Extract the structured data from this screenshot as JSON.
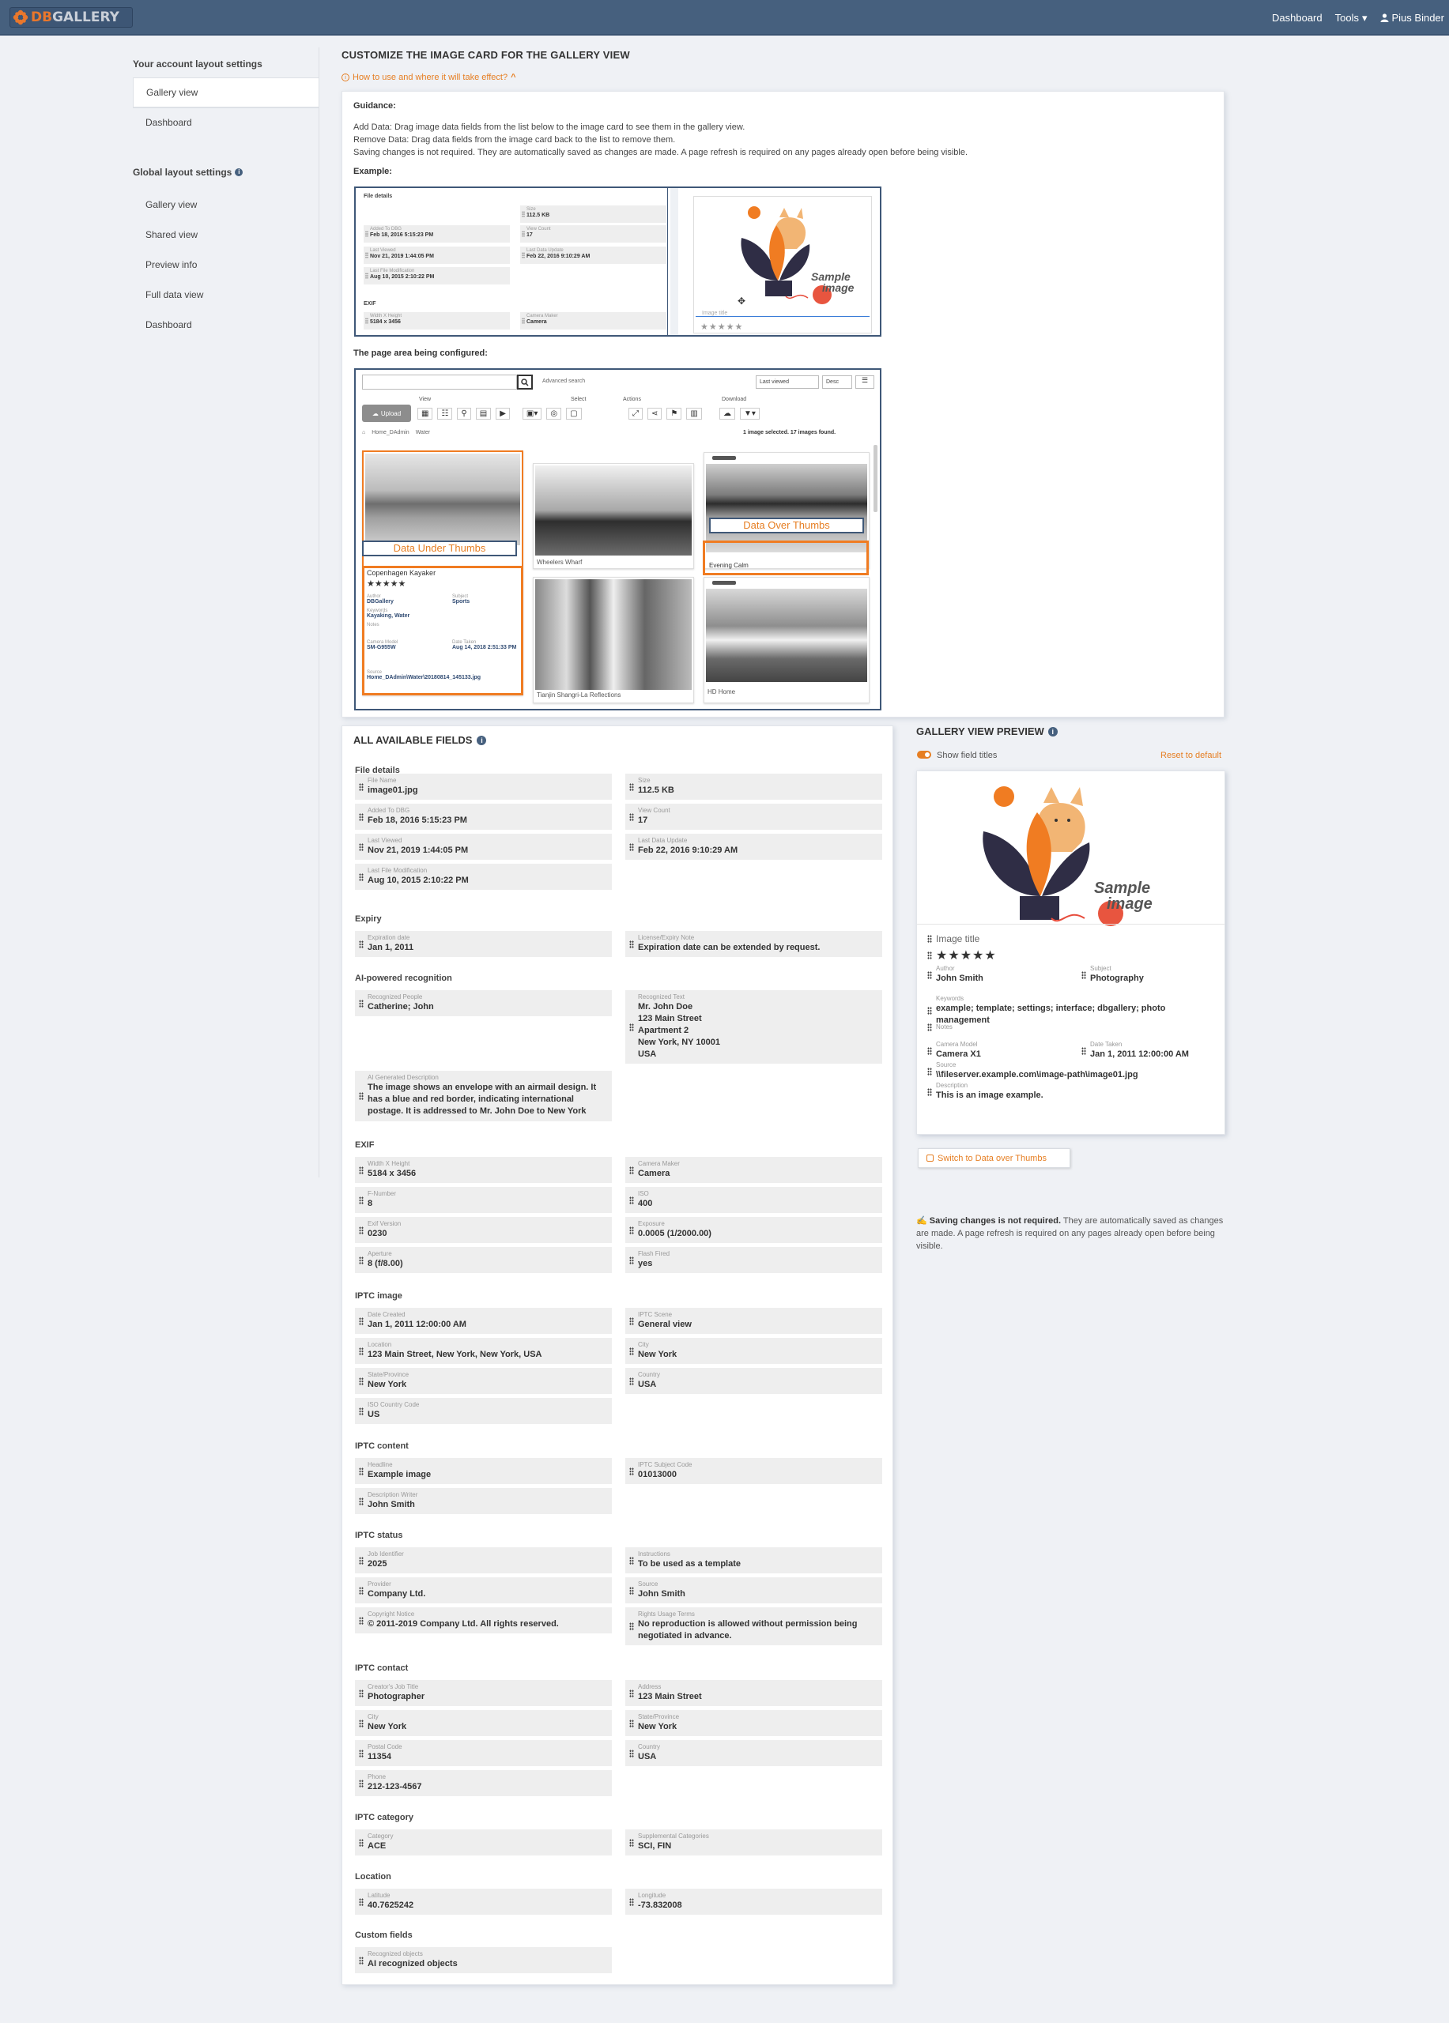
{
  "brand": {
    "logo_text_a": "DB",
    "logo_text_b": "GALLERY"
  },
  "topnav": {
    "dashboard": "Dashboard",
    "tools": "Tools",
    "user": "Pius Binder"
  },
  "sidebar": {
    "account_heading": "Your account layout settings",
    "account_items": [
      {
        "label": "Gallery view"
      },
      {
        "label": "Dashboard"
      }
    ],
    "global_heading": "Global layout settings",
    "global_items": [
      {
        "label": "Gallery view"
      },
      {
        "label": "Shared view"
      },
      {
        "label": "Preview info"
      },
      {
        "label": "Full data view"
      },
      {
        "label": "Dashboard"
      }
    ]
  },
  "main": {
    "title": "CUSTOMIZE THE IMAGE CARD FOR THE GALLERY VIEW",
    "howto": "How to use and where it will take effect?",
    "guidance_heading": "Guidance:",
    "guidance_lines": [
      "Add Data: Drag image data fields from the list below to the image card to see them in the gallery view.",
      "Remove Data: Drag data fields from the image card back to the list to remove them.",
      "Saving changes is not required. They are automatically saved as changes are made. A page refresh is required on any pages already open before being visible."
    ],
    "example_heading": "Example:",
    "page_area_heading": "The page area being configured:"
  },
  "example": {
    "file_details": "File details",
    "exif": "EXIF",
    "fields": [
      {
        "label": "Size",
        "value": "112.5 KB"
      },
      {
        "label": "Added To DBG",
        "value": "Feb 18, 2016 5:15:23 PM"
      },
      {
        "label": "View Count",
        "value": "17"
      },
      {
        "label": "Last Viewed",
        "value": "Nov 21, 2019 1:44:05 PM"
      },
      {
        "label": "Last Data Update",
        "value": "Feb 22, 2016 9:10:29 AM"
      },
      {
        "label": "Last File Modification",
        "value": "Aug 10, 2015 2:10:22 PM"
      },
      {
        "label": "Width X Height",
        "value": "5184 x 3456"
      },
      {
        "label": "Camera Maker",
        "value": "Camera"
      }
    ],
    "card_title_placeholder": "Image title",
    "sample_text": "Sample image"
  },
  "page_area": {
    "advanced_search": "Advanced search",
    "sort": "Last viewed",
    "order": "Desc",
    "upload": "Upload",
    "groups": [
      "View",
      "Select",
      "Actions",
      "Download"
    ],
    "breadcrumb": [
      "Home_DAdmin",
      "Water"
    ],
    "status": "1 image selected. 17 images found.",
    "data_under": "Data Under Thumbs",
    "data_over": "Data Over Thumbs",
    "tiles": [
      "Copenhagen Kayaker",
      "Wheelers Wharf",
      "Evening Calm",
      "Tianjin Shangri-La Reflections",
      "HD Home"
    ],
    "card_fields": [
      {
        "label": "Author",
        "value": "DBGallery"
      },
      {
        "label": "Subject",
        "value": "Sports"
      },
      {
        "label": "Keywords",
        "value": "Kayaking, Water"
      },
      {
        "label": "Notes",
        "value": ""
      },
      {
        "label": "Camera Model",
        "value": "SM-G955W"
      },
      {
        "label": "Date Taken",
        "value": "Aug 14, 2018 2:51:33 PM"
      },
      {
        "label": "Source",
        "value": "Home_DAdmin\\Water\\20180814_145133.jpg"
      }
    ]
  },
  "fields_panel": {
    "title": "ALL AVAILABLE FIELDS",
    "sections": [
      {
        "name": "File details"
      },
      {
        "name": "Expiry"
      },
      {
        "name": "AI-powered recognition"
      },
      {
        "name": "EXIF"
      },
      {
        "name": "IPTC image"
      },
      {
        "name": "IPTC content"
      },
      {
        "name": "IPTC status"
      },
      {
        "name": "IPTC contact"
      },
      {
        "name": "IPTC category"
      },
      {
        "name": "Location"
      },
      {
        "name": "Custom fields"
      }
    ],
    "fields": [
      {
        "label": "File Name",
        "value": "image01.jpg"
      },
      {
        "label": "Size",
        "value": "112.5 KB"
      },
      {
        "label": "Added To DBG",
        "value": "Feb 18, 2016 5:15:23 PM"
      },
      {
        "label": "View Count",
        "value": "17"
      },
      {
        "label": "Last Viewed",
        "value": "Nov 21, 2019 1:44:05 PM"
      },
      {
        "label": "Last Data Update",
        "value": "Feb 22, 2016 9:10:29 AM"
      },
      {
        "label": "Last File Modification",
        "value": "Aug 10, 2015 2:10:22 PM"
      },
      {
        "label": "Expiration date",
        "value": "Jan 1, 2011"
      },
      {
        "label": "License/Expiry Note",
        "value": "Expiration date can be extended by request."
      },
      {
        "label": "Recognized People",
        "value": "Catherine; John"
      },
      {
        "label": "Recognized Text",
        "value": "Mr. John Doe\n123 Main Street\nApartment 2\nNew York, NY 10001\nUSA"
      },
      {
        "label": "AI Generated Description",
        "value": "The image shows an envelope with an airmail design. It has a blue and red border, indicating international postage. It is addressed to Mr. John Doe to New York"
      },
      {
        "label": "Width X Height",
        "value": "5184 x 3456"
      },
      {
        "label": "Camera Maker",
        "value": "Camera"
      },
      {
        "label": "F-Number",
        "value": "8"
      },
      {
        "label": "ISO",
        "value": "400"
      },
      {
        "label": "Exif Version",
        "value": "0230"
      },
      {
        "label": "Exposure",
        "value": "0.0005 (1/2000.00)"
      },
      {
        "label": "Aperture",
        "value": "8 (f/8.00)"
      },
      {
        "label": "Flash Fired",
        "value": "yes"
      },
      {
        "label": "Date Created",
        "value": "Jan 1, 2011 12:00:00 AM"
      },
      {
        "label": "IPTC Scene",
        "value": "General view"
      },
      {
        "label": "Location",
        "value": "123 Main Street, New York, New York, USA"
      },
      {
        "label": "City",
        "value": "New York"
      },
      {
        "label": "State/Province",
        "value": "New York"
      },
      {
        "label": "Country",
        "value": "USA"
      },
      {
        "label": "ISO Country Code",
        "value": "US"
      },
      {
        "label": "Headline",
        "value": "Example image"
      },
      {
        "label": "IPTC Subject Code",
        "value": "01013000"
      },
      {
        "label": "Description Writer",
        "value": "John Smith"
      },
      {
        "label": "Job Identifier",
        "value": "2025"
      },
      {
        "label": "Instructions",
        "value": "To be used as a template"
      },
      {
        "label": "Provider",
        "value": "Company Ltd."
      },
      {
        "label": "Source",
        "value": "John Smith"
      },
      {
        "label": "Copyright Notice",
        "value": "© 2011-2019 Company Ltd. All rights reserved."
      },
      {
        "label": "Rights Usage Terms",
        "value": "No reproduction is allowed without permission being negotiated in advance."
      },
      {
        "label": "Creator's Job Title",
        "value": "Photographer"
      },
      {
        "label": "Address",
        "value": "123 Main Street"
      },
      {
        "label": "City",
        "value": "New York"
      },
      {
        "label": "State/Province",
        "value": "New York"
      },
      {
        "label": "Postal Code",
        "value": "11354"
      },
      {
        "label": "Country",
        "value": "USA"
      },
      {
        "label": "Phone",
        "value": "212-123-4567"
      },
      {
        "label": "Category",
        "value": "ACE"
      },
      {
        "label": "Supplemental Categories",
        "value": "SCI, FIN"
      },
      {
        "label": "Latitude",
        "value": "40.7625242"
      },
      {
        "label": "Longitude",
        "value": "-73.832008"
      },
      {
        "label": "Recognized objects",
        "value": "AI recognized objects"
      }
    ]
  },
  "preview": {
    "title": "GALLERY VIEW PREVIEW",
    "show_titles": "Show field titles",
    "reset": "Reset to default",
    "sample_text": "Sample image",
    "image_title": "Image title",
    "stars": "★★★★★",
    "fields": [
      {
        "label": "Author",
        "value": "John Smith"
      },
      {
        "label": "Subject",
        "value": "Photography"
      },
      {
        "label": "Keywords",
        "value": "example; template; settings; interface; dbgallery; photo management"
      },
      {
        "label": "Notes",
        "value": ""
      },
      {
        "label": "Camera Model",
        "value": "Camera X1"
      },
      {
        "label": "Date Taken",
        "value": "Jan 1, 2011 12:00:00 AM"
      },
      {
        "label": "Source",
        "value": "\\\\fileserver.example.com\\image-path\\image01.jpg"
      },
      {
        "label": "Description",
        "value": "This is an image example."
      }
    ],
    "switch_button": "Switch to Data over Thumbs",
    "save_note_bold": "Saving changes is not required.",
    "save_note_rest": " They are automatically saved as changes are made. A page refresh is required on any pages already open before being visible."
  },
  "colors": {
    "topbar": "#46607e",
    "accent": "#e67e22",
    "page_bg": "#eff1f5"
  }
}
